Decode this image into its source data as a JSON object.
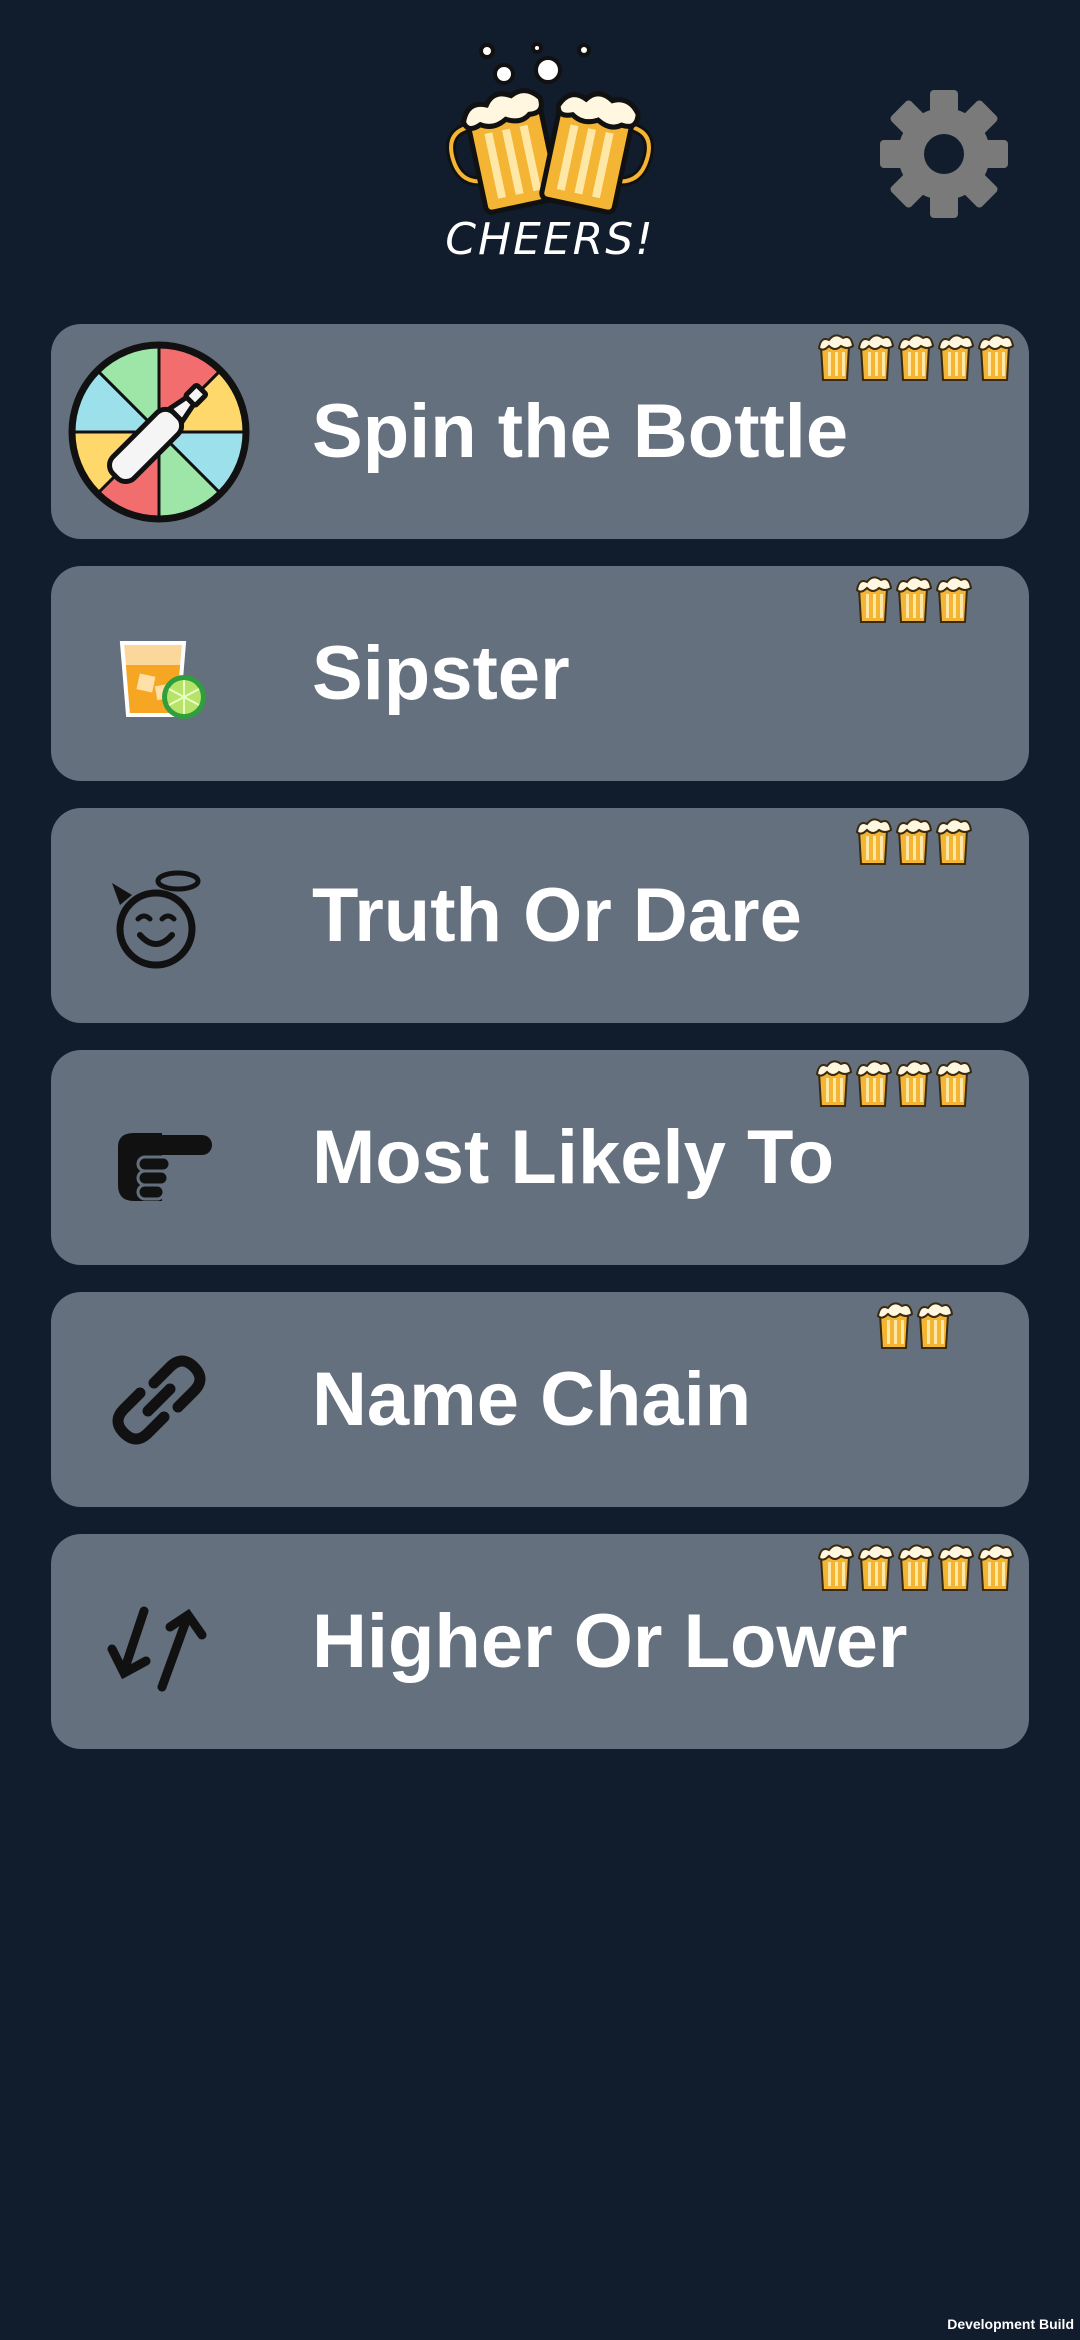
{
  "app": {
    "logo_text": "CHEERS!",
    "logo_icon": "beer-mugs-toast-icon",
    "settings_icon": "gear-icon"
  },
  "games": [
    {
      "label": "Spin the Bottle",
      "icon": "spin-wheel-bottle-icon",
      "rating": 5
    },
    {
      "label": "Sipster",
      "icon": "cocktail-glass-lime-icon",
      "rating": 3
    },
    {
      "label": "Truth Or Dare",
      "icon": "smiling-face-halo-horns-icon",
      "rating": 3
    },
    {
      "label": "Most Likely To",
      "icon": "pointing-hand-icon",
      "rating": 4
    },
    {
      "label": "Name Chain",
      "icon": "chain-link-icon",
      "rating": 2
    },
    {
      "label": "Higher Or Lower",
      "icon": "up-down-arrows-icon",
      "rating": 5
    }
  ],
  "footer": {
    "build_label": "Development Build"
  },
  "colors": {
    "background": "#111c2c",
    "card": "#64707e",
    "text": "#ffffff",
    "beer": "#f4b434",
    "gear": "#7a7a7a"
  }
}
